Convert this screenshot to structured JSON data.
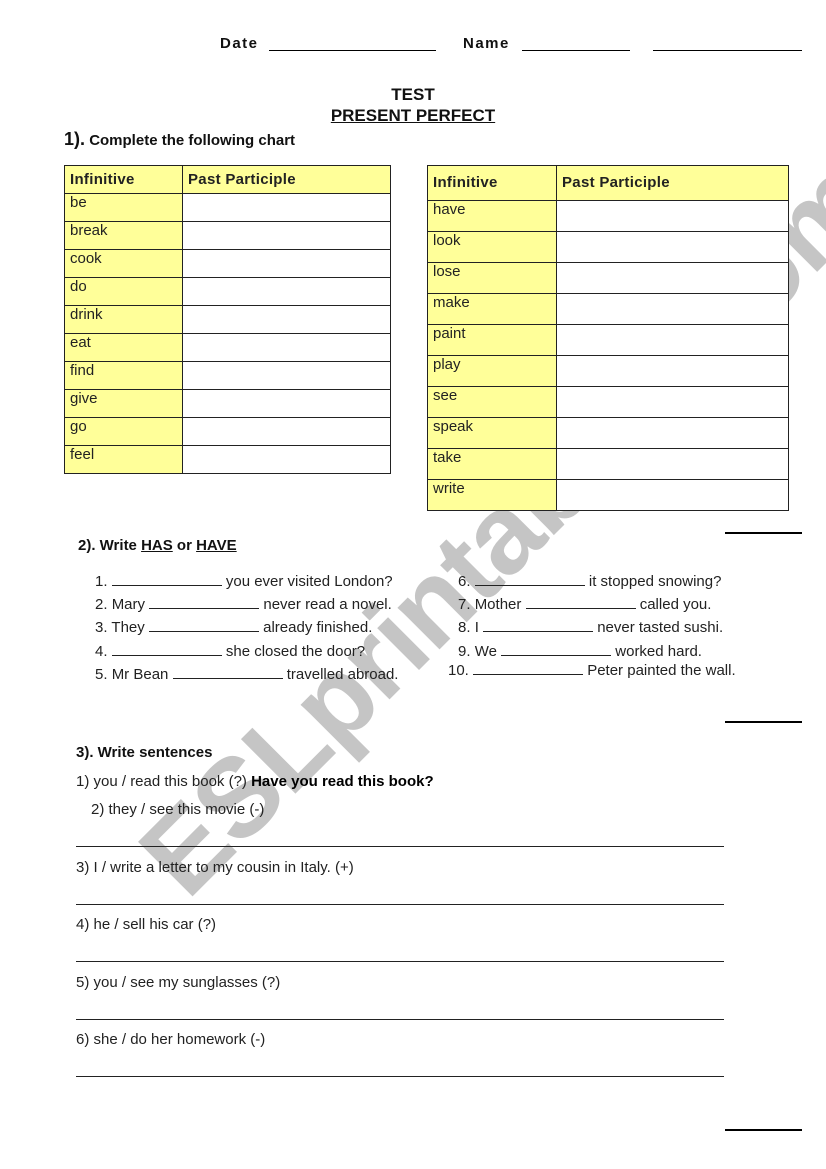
{
  "header": {
    "date_label": "Date",
    "name_label": "Name"
  },
  "title": {
    "line1": "TEST",
    "line2": "PRESENT PERFECT"
  },
  "section1": {
    "number": "1).",
    "heading": "Complete the following chart",
    "table_left": {
      "headers": [
        "Infinitive",
        "Past Participle"
      ],
      "rows": [
        "be",
        "break",
        "cook",
        "do",
        "drink",
        "eat",
        "find",
        "give",
        "go",
        "feel"
      ]
    },
    "table_right": {
      "headers": [
        "Infinitive",
        "Past Participle"
      ],
      "rows": [
        "have",
        "look",
        "lose",
        "make",
        "paint",
        "play",
        "see",
        "speak",
        "take",
        "write"
      ]
    }
  },
  "section2": {
    "prefix": "2). Write",
    "has": "HAS",
    "or": "or",
    "have": "HAVE",
    "items_left": [
      {
        "num": "1.",
        "before": "",
        "after": "you ever visited London?"
      },
      {
        "num": "2.",
        "before": "Mary",
        "after": "never read a novel."
      },
      {
        "num": "3.",
        "before": "They",
        "after": "already finished."
      },
      {
        "num": "4.",
        "before": "",
        "after": "she closed the door?"
      },
      {
        "num": "5.",
        "before": "Mr Bean",
        "after": "travelled abroad."
      }
    ],
    "items_right": [
      {
        "num": "6.",
        "before": "",
        "after": "it stopped snowing?"
      },
      {
        "num": "7.",
        "before": "Mother",
        "after": "called you."
      },
      {
        "num": "8.",
        "before": "I",
        "after": "never tasted sushi."
      },
      {
        "num": "9.",
        "before": "We",
        "after": "worked hard."
      },
      {
        "num": "10.",
        "before": "",
        "after": "Peter painted the wall."
      }
    ]
  },
  "section3": {
    "heading": "3). Write sentences",
    "example_prompt": "1) you / read this book (?)",
    "example_answer": "Have you read this book?",
    "prompts": [
      "2) they / see this movie (-)",
      "3) I / write a letter to my cousin in Italy. (+)",
      "4) he / sell his car (?)",
      "5) you / see my sunglasses (?)",
      "6) she / do her homework (-)"
    ]
  },
  "watermark": "ESLprintables.com"
}
